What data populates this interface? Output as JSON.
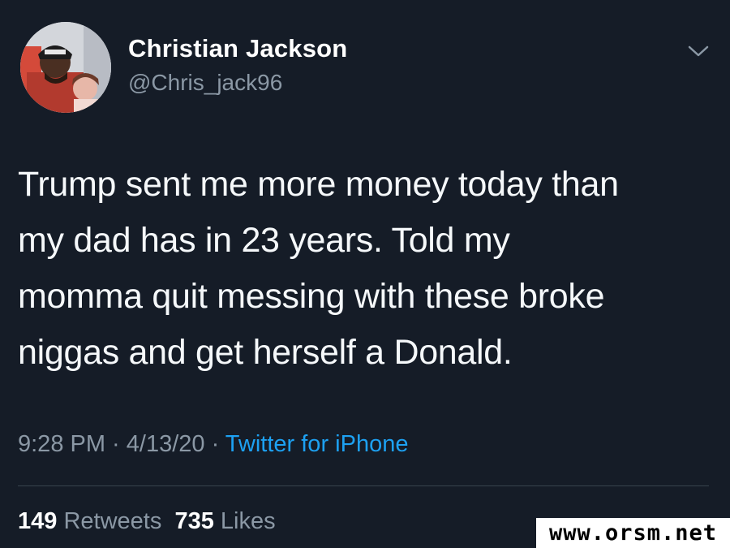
{
  "author": {
    "display_name": "Christian Jackson",
    "handle": "@Chris_jack96",
    "avatar_icon": "profile-photo"
  },
  "menu_icon": "chevron-down-icon",
  "tweet": {
    "lines": [
      "Trump sent me more money today than",
      "my dad has in 23 years. Told my",
      "momma quit messing with these broke",
      "niggas and get herself a Donald."
    ]
  },
  "meta": {
    "time": "9:28 PM",
    "separator1": " · ",
    "date": "4/13/20",
    "separator2": " · ",
    "source": "Twitter for iPhone"
  },
  "stats": {
    "retweets_count": "149",
    "retweets_label": "Retweets",
    "likes_count": "735",
    "likes_label": "Likes"
  },
  "watermark": "www.orsm.net",
  "colors": {
    "background": "#151c27",
    "secondary_text": "#8b98a5",
    "link": "#1da1f2",
    "divider": "#38444d"
  }
}
